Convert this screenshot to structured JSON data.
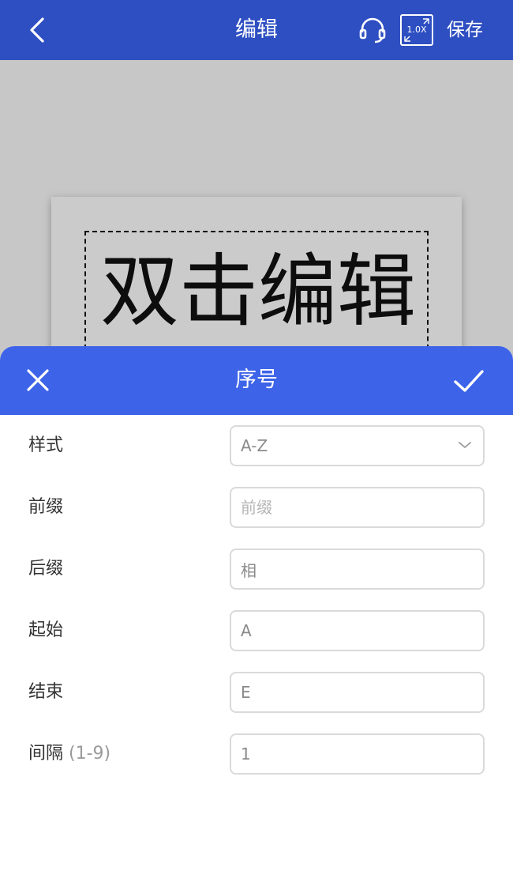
{
  "topbar": {
    "title": "编辑",
    "zoom_label": "1.0X",
    "save_label": "保存"
  },
  "canvas": {
    "label_text": "双击编辑"
  },
  "sheet": {
    "title": "序号",
    "fields": {
      "style": {
        "label": "样式",
        "value": "A-Z"
      },
      "prefix": {
        "label": "前缀",
        "placeholder": "前缀",
        "value": ""
      },
      "suffix": {
        "label": "后缀",
        "value": "相"
      },
      "start": {
        "label": "起始",
        "value": "A"
      },
      "end": {
        "label": "结束",
        "value": "E"
      },
      "interval": {
        "label": "间隔",
        "hint": "(1-9)",
        "value": "1"
      }
    }
  },
  "colors": {
    "topbar_bg": "#2e4fc2",
    "sheet_header_bg": "#3d63e8",
    "canvas_bg": "#c7c7c7"
  },
  "icons": {
    "back": "chevron-left-icon",
    "support": "headset-icon",
    "zoom": "expand-icon",
    "close": "close-icon",
    "confirm": "check-icon",
    "dropdown": "chevron-down-icon"
  }
}
